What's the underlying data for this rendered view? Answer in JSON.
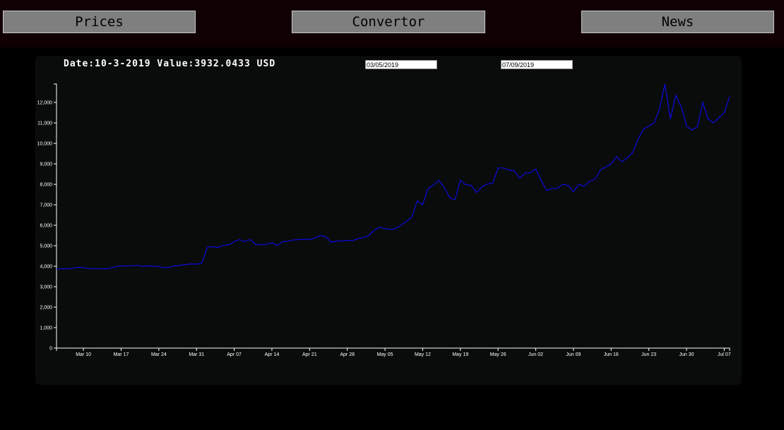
{
  "nav": {
    "prices_label": "Prices",
    "convertor_label": "Convertor",
    "news_label": "News"
  },
  "info": {
    "date_label": "Date:",
    "date_value": "10-3-2019",
    "value_label": "Value:",
    "value_amount": "3932.0433",
    "currency": "USD"
  },
  "range": {
    "start_date": "03/05/2019",
    "end_date": "07/09/2019"
  },
  "colors": {
    "line": "#0b0bd0",
    "axis": "#ffffff",
    "panel_bg": "#0a0b0b",
    "topbar_bg": "#110003",
    "button_bg": "#7f7f7f"
  },
  "chart_data": {
    "type": "line",
    "title": "",
    "xlabel": "",
    "ylabel": "",
    "ylim": [
      0,
      12900
    ],
    "xlim": [
      "2019-03-05",
      "2019-07-08"
    ],
    "x_tick_labels": [
      "Mar 10",
      "Mar 17",
      "Mar 24",
      "Mar 31",
      "Apr 07",
      "Apr 14",
      "Apr 21",
      "Apr 28",
      "May 05",
      "May 12",
      "May 19",
      "May 26",
      "Jun 02",
      "Jun 09",
      "Jun 16",
      "Jun 23",
      "Jun 30",
      "Jul 07"
    ],
    "y_ticks": [
      0,
      1000,
      2000,
      3000,
      4000,
      5000,
      6000,
      7000,
      8000,
      9000,
      10000,
      11000,
      12000
    ],
    "grid": false,
    "series": [
      {
        "x": [
          "2019-03-05",
          "2019-03-06",
          "2019-03-07",
          "2019-03-08",
          "2019-03-09",
          "2019-03-10",
          "2019-03-11",
          "2019-03-12",
          "2019-03-13",
          "2019-03-14",
          "2019-03-15",
          "2019-03-16",
          "2019-03-17",
          "2019-03-18",
          "2019-03-19",
          "2019-03-20",
          "2019-03-21",
          "2019-03-22",
          "2019-03-23",
          "2019-03-24",
          "2019-03-25",
          "2019-03-26",
          "2019-03-27",
          "2019-03-28",
          "2019-03-29",
          "2019-03-30",
          "2019-03-31",
          "2019-04-01",
          "2019-04-02",
          "2019-04-03",
          "2019-04-04",
          "2019-04-05",
          "2019-04-06",
          "2019-04-07",
          "2019-04-08",
          "2019-04-09",
          "2019-04-10",
          "2019-04-11",
          "2019-04-12",
          "2019-04-13",
          "2019-04-14",
          "2019-04-15",
          "2019-04-16",
          "2019-04-17",
          "2019-04-18",
          "2019-04-19",
          "2019-04-20",
          "2019-04-21",
          "2019-04-22",
          "2019-04-23",
          "2019-04-24",
          "2019-04-25",
          "2019-04-26",
          "2019-04-27",
          "2019-04-28",
          "2019-04-29",
          "2019-04-30",
          "2019-05-01",
          "2019-05-02",
          "2019-05-03",
          "2019-05-04",
          "2019-05-05",
          "2019-05-06",
          "2019-05-07",
          "2019-05-08",
          "2019-05-09",
          "2019-05-10",
          "2019-05-11",
          "2019-05-12",
          "2019-05-13",
          "2019-05-14",
          "2019-05-15",
          "2019-05-16",
          "2019-05-17",
          "2019-05-18",
          "2019-05-19",
          "2019-05-20",
          "2019-05-21",
          "2019-05-22",
          "2019-05-23",
          "2019-05-24",
          "2019-05-25",
          "2019-05-26",
          "2019-05-27",
          "2019-05-28",
          "2019-05-29",
          "2019-05-30",
          "2019-05-31",
          "2019-06-01",
          "2019-06-02",
          "2019-06-03",
          "2019-06-04",
          "2019-06-05",
          "2019-06-06",
          "2019-06-07",
          "2019-06-08",
          "2019-06-09",
          "2019-06-10",
          "2019-06-11",
          "2019-06-12",
          "2019-06-13",
          "2019-06-14",
          "2019-06-15",
          "2019-06-16",
          "2019-06-17",
          "2019-06-18",
          "2019-06-19",
          "2019-06-20",
          "2019-06-21",
          "2019-06-22",
          "2019-06-23",
          "2019-06-24",
          "2019-06-25",
          "2019-06-26",
          "2019-06-27",
          "2019-06-28",
          "2019-06-29",
          "2019-06-30",
          "2019-07-01",
          "2019-07-02",
          "2019-07-03",
          "2019-07-04",
          "2019-07-05",
          "2019-07-06",
          "2019-07-07",
          "2019-07-08"
        ],
        "values": [
          3860,
          3880,
          3870,
          3900,
          3950,
          3932,
          3880,
          3880,
          3880,
          3870,
          3900,
          3980,
          4020,
          4010,
          4020,
          4040,
          4000,
          4010,
          4000,
          3990,
          3920,
          3950,
          4020,
          4050,
          4080,
          4110,
          4100,
          4150,
          4920,
          4960,
          4920,
          5020,
          5050,
          5200,
          5300,
          5200,
          5300,
          5050,
          5060,
          5070,
          5150,
          5000,
          5200,
          5230,
          5280,
          5300,
          5320,
          5300,
          5380,
          5500,
          5450,
          5180,
          5220,
          5240,
          5260,
          5250,
          5350,
          5400,
          5500,
          5750,
          5900,
          5830,
          5800,
          5840,
          6000,
          6200,
          6400,
          7200,
          7000,
          7800,
          7960,
          8200,
          7850,
          7350,
          7250,
          8200,
          7980,
          7950,
          7600,
          7880,
          8020,
          8050,
          8800,
          8800,
          8700,
          8660,
          8300,
          8550,
          8560,
          8750,
          8200,
          7700,
          7800,
          7800,
          8000,
          7950,
          7650,
          8000,
          7900,
          8150,
          8250,
          8700,
          8850,
          9000,
          9350,
          9100,
          9300,
          9550,
          10200,
          10700,
          10850,
          11000,
          11700,
          12900,
          11200,
          12350,
          11800,
          10850,
          10650,
          10800,
          12000,
          11200,
          11000,
          11250,
          11500,
          12300
        ]
      }
    ]
  }
}
